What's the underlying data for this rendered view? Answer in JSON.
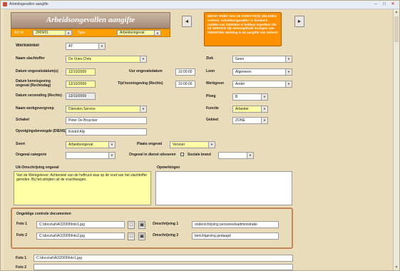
{
  "window": {
    "title": "Arbeidsgevallen aangifte"
  },
  "header": {
    "title": "Arbeidsongevallen aangifte",
    "filter": {
      "label1": "AO nr",
      "value1": "2009/01",
      "label2": "Type",
      "value2": "Arbeidsongeval"
    },
    "warning": "EERST REEK VAN DE KWESTIE(S) GELEZEN Gelieve: Arbeidsongevallen nr kenmerk melden van DERDEN te hebben ingedient die bij SERVICE zijn Bevoegdheid inroepen aan DIENSTEN. Melding in de aangifte van Sales!!!"
  },
  "form": {
    "werkwinkel": {
      "label": "Werkwinkel",
      "value": "AT"
    },
    "naam_slachtoffer": {
      "label": "Naam slachtoffer",
      "value": "De Vries Chris"
    },
    "datum_ongeval": {
      "label": "Datum ongevalsdatum(s)",
      "value": "12/10/2009"
    },
    "uur_ongeval": {
      "label": "Uur ongevalsdatum",
      "value": "10:00:00"
    },
    "datum_aangifte": {
      "label": "Datum kennisgeving ongeval (Rechtsdag)",
      "value": "13/10/2009"
    },
    "tijd_aangifte": {
      "label": "Tijd kennisgeving (Rechts)",
      "value": "10:00:00"
    },
    "datum_verzending": {
      "label": "Datum verzending (Rechts)",
      "value": "13/10/2009"
    },
    "naam_werkgever": {
      "label": "Naam werkgevergroep",
      "value": "Diensten Service"
    },
    "schakel": {
      "label": "Schakel",
      "value": "Peter De Bruycker"
    },
    "opvolger": {
      "label": "Opvolgingsbevoegde (DIENS)",
      "value": "Kristof Ally"
    },
    "soort": {
      "label": "Soort",
      "value": "Arbeidsongeval"
    },
    "plaats": {
      "label": "Plaats ongeval",
      "value": "Vervoer"
    },
    "ongeval_categorie": {
      "label": "Ongeval categorie",
      "value": ""
    },
    "ongeval_in_dienst": {
      "label": "Ongeval in dienst uitvoeren",
      "value": ""
    },
    "sociale_brand": {
      "label": "Sociale brand",
      "value": ""
    },
    "ziek": {
      "label": "Ziek",
      "value": "Geen"
    },
    "loon": {
      "label": "Loon",
      "value": "Algemeen"
    },
    "werkgever_r": {
      "label": "Werkgever",
      "value": "Ander"
    },
    "ploeg": {
      "label": "Ploeg",
      "value": "B"
    },
    "functie": {
      "label": "Functie",
      "value": "Arbeider"
    },
    "gebied": {
      "label": "Gebied",
      "value": "ZONE"
    },
    "omschrijving": {
      "label": "Uit-Omschrijving ongeval",
      "value": "Van de Werkgelever: Achterwiel van de heftruck was op de voet van het slachtoffer gereden. Bij het uitrijden uit de vrachtwagen."
    },
    "opmerkingen": {
      "label": "Opmerkingen",
      "value": ""
    }
  },
  "documents": {
    "title": "Ongeldige controle documenten",
    "rows": [
      {
        "label": "Foto 1",
        "path": "C:\\docs\\uit\\AO2009\\foto1.jpg",
        "desc_label": "Omschrijving 1",
        "desc_value": "onderschrijving personeelsadministratie"
      },
      {
        "label": "Foto 2",
        "path": "C:\\docs\\uit\\AO2009\\foto2.jpg",
        "desc_label": "Omschrijving 2",
        "desc_value": "berichtgeving gedaagd"
      }
    ]
  },
  "bottom": {
    "row1": {
      "label": "Foto 1",
      "value": "C:\\docs\\uit\\AO2009\\foto1.jpg"
    },
    "row2": {
      "label": "Foto 2",
      "value": ""
    }
  }
}
